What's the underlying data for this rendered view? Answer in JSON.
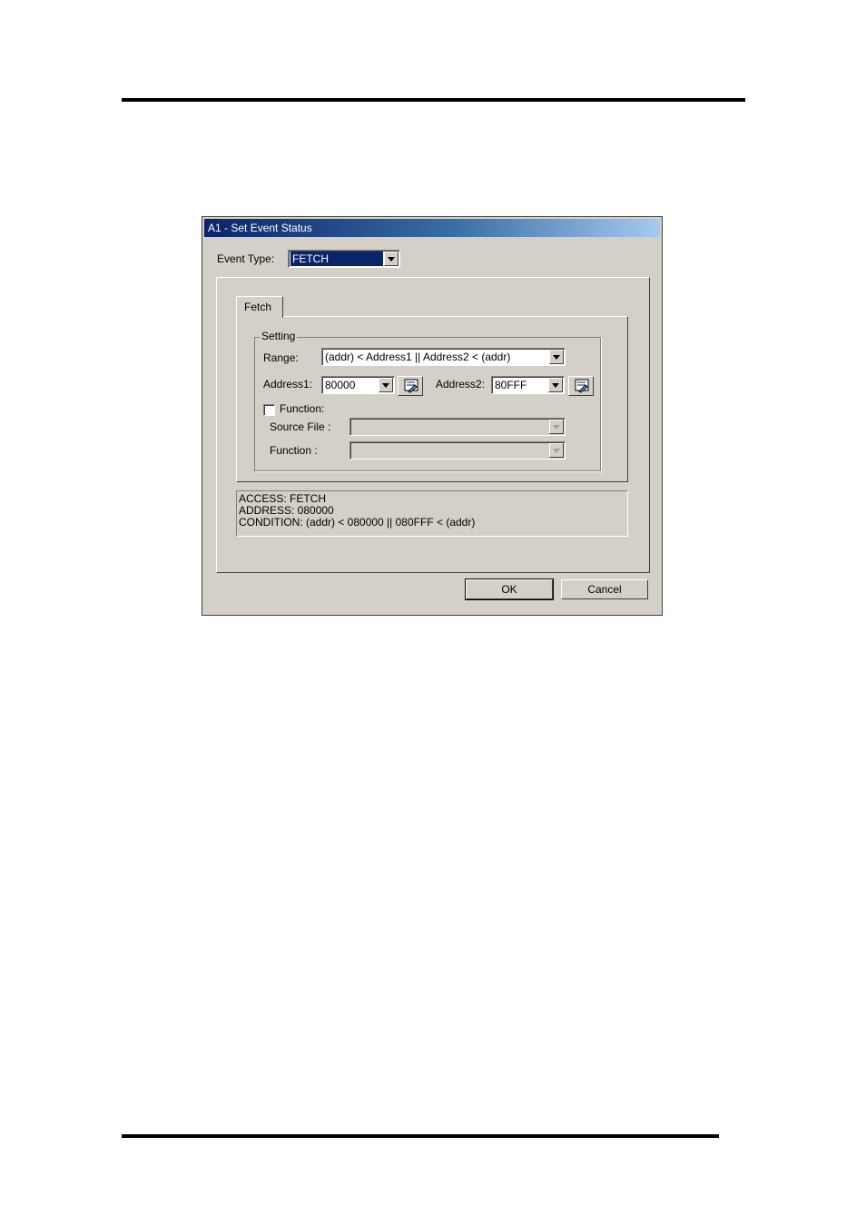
{
  "dialog": {
    "title": "A1 - Set Event Status",
    "event_type_label": "Event Type:",
    "event_type_value": "FETCH",
    "tab_label": "Fetch",
    "setting_group_label": "Setting",
    "range_label": "Range:",
    "range_value": "(addr) < Address1 || Address2 < (addr)",
    "address1_label": "Address1:",
    "address1_value": "80000",
    "address2_label": "Address2:",
    "address2_value": "80FFF",
    "function_checkbox_label": "Function:",
    "function_checked": false,
    "source_file_label": "Source File :",
    "function_label": "Function :",
    "info_lines": [
      "ACCESS: FETCH",
      "ADDRESS: 080000",
      "CONDITION: (addr) < 080000 || 080FFF < (addr)"
    ],
    "ok_label": "OK",
    "cancel_label": "Cancel"
  }
}
